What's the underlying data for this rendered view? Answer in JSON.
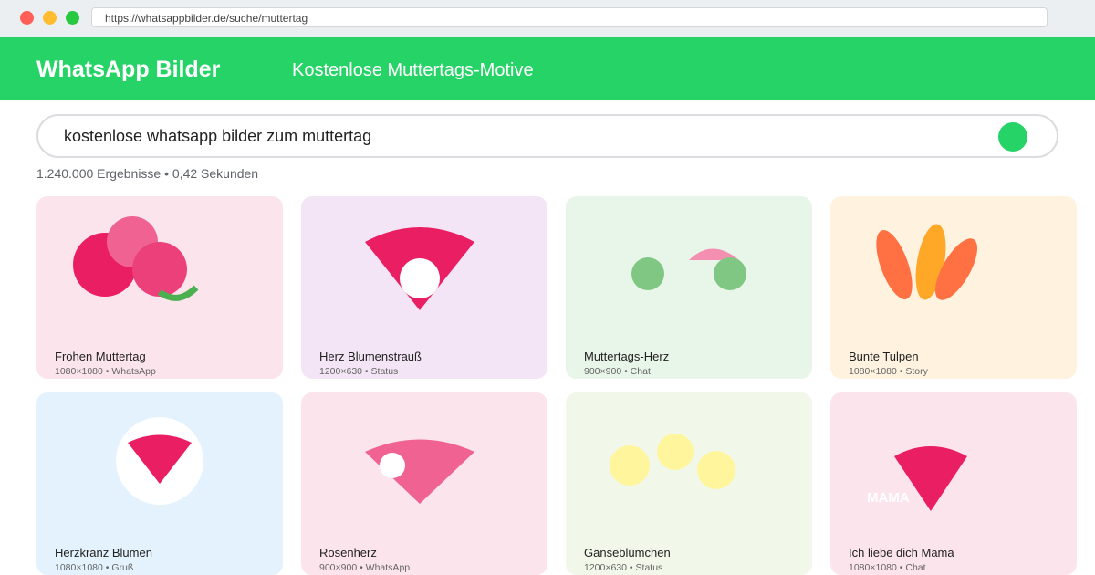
{
  "browser": {
    "url": "https://whatsappbilder.de/suche/muttertag"
  },
  "header": {
    "brand": "WhatsApp Bilder",
    "subtitle": "Kostenlose Muttertags-Motive"
  },
  "search": {
    "query": "kostenlose whatsapp bilder zum muttertag",
    "results_info": "1.240.000 Ergebnisse • 0,42 Sekunden"
  },
  "colors": {
    "accent": "#25d366"
  },
  "results": [
    {
      "title": "Frohen Muttertag",
      "meta": "1080×1080 • WhatsApp",
      "bg": "#fce4ec"
    },
    {
      "title": "Herz Blumenstrauß",
      "meta": "1200×630 • Status",
      "bg": "#f3e5f5"
    },
    {
      "title": "Muttertags-Herz",
      "meta": "900×900 • Chat",
      "bg": "#e8f5e9"
    },
    {
      "title": "Bunte Tulpen",
      "meta": "1080×1080 • Story",
      "bg": "#fff3e0"
    },
    {
      "title": "Herzkranz Blumen",
      "meta": "1080×1080 • Gruß",
      "bg": "#e3f2fd"
    },
    {
      "title": "Rosenherz",
      "meta": "900×900 • WhatsApp",
      "bg": "#fce4ec"
    },
    {
      "title": "Gänseblümchen",
      "meta": "1200×630 • Status",
      "bg": "#f1f8e9"
    },
    {
      "title": "Ich liebe dich Mama",
      "meta": "1080×1080 • Chat",
      "bg": "#fce4ec",
      "overlay_text": "MAMA"
    }
  ]
}
